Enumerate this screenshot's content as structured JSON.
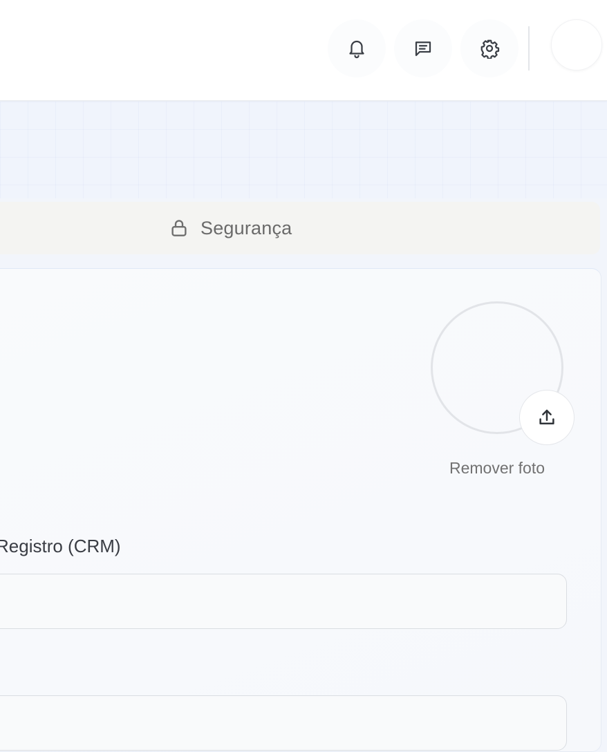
{
  "header": {
    "icons": {
      "notifications": "bell-icon",
      "messages": "message-square-icon",
      "settings": "gear-icon"
    }
  },
  "tabs": {
    "security_label": "Segurança",
    "security_icon": "lock-icon"
  },
  "profile": {
    "upload_icon": "upload-icon",
    "remove_photo_label": "Remover foto"
  },
  "form": {
    "crm_label": "Registro (CRM)",
    "crm_value": "",
    "next_field_value": ""
  },
  "colors": {
    "header_bg": "#ffffff",
    "page_bg": "#f2f5fb",
    "tab_bar_bg": "#f4f4f2",
    "card_bg": "#f8f9fc",
    "muted_text": "#6a6a6a",
    "label_text": "#3a3d44",
    "input_border": "#dadde2"
  }
}
